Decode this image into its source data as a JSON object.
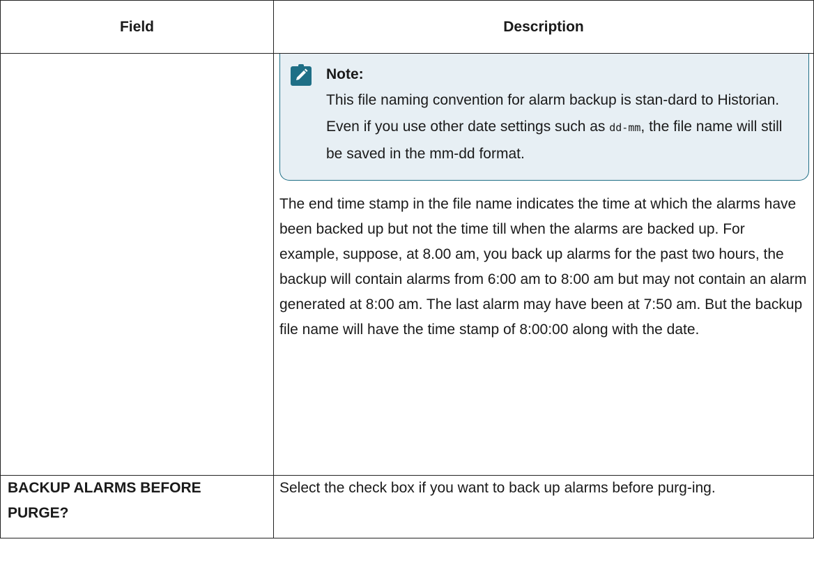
{
  "table": {
    "headers": {
      "field": "Field",
      "description": "Description"
    },
    "note": {
      "icon": "pencil-note-icon",
      "title": "Note:",
      "text_before": "This file naming convention for alarm backup is stan-dard to Historian. Even if you use other date settings such as ",
      "code": "dd-mm",
      "text_after": ", the file name will still be saved in the mm-dd format."
    },
    "paragraph": "The end time stamp in the file name indicates the time at which the alarms have been backed up but not the time till when the alarms are backed up. For example, suppose, at 8.00 am, you back up alarms for the past two hours, the backup will contain alarms from 6:00 am to 8:00 am but may not contain an alarm generated at 8:00 am. The last alarm may have been at 7:50 am. But the backup file name will have the time stamp of 8:00:00 along with the date.",
    "row2": {
      "field": "BACKUP ALARMS BEFORE PURGE?",
      "description": "Select the check box if you want to back up alarms before purg-ing."
    }
  },
  "colors": {
    "note_border": "#1f6f86",
    "note_background": "#e7eff4",
    "icon_fill": "#1f6f86"
  }
}
